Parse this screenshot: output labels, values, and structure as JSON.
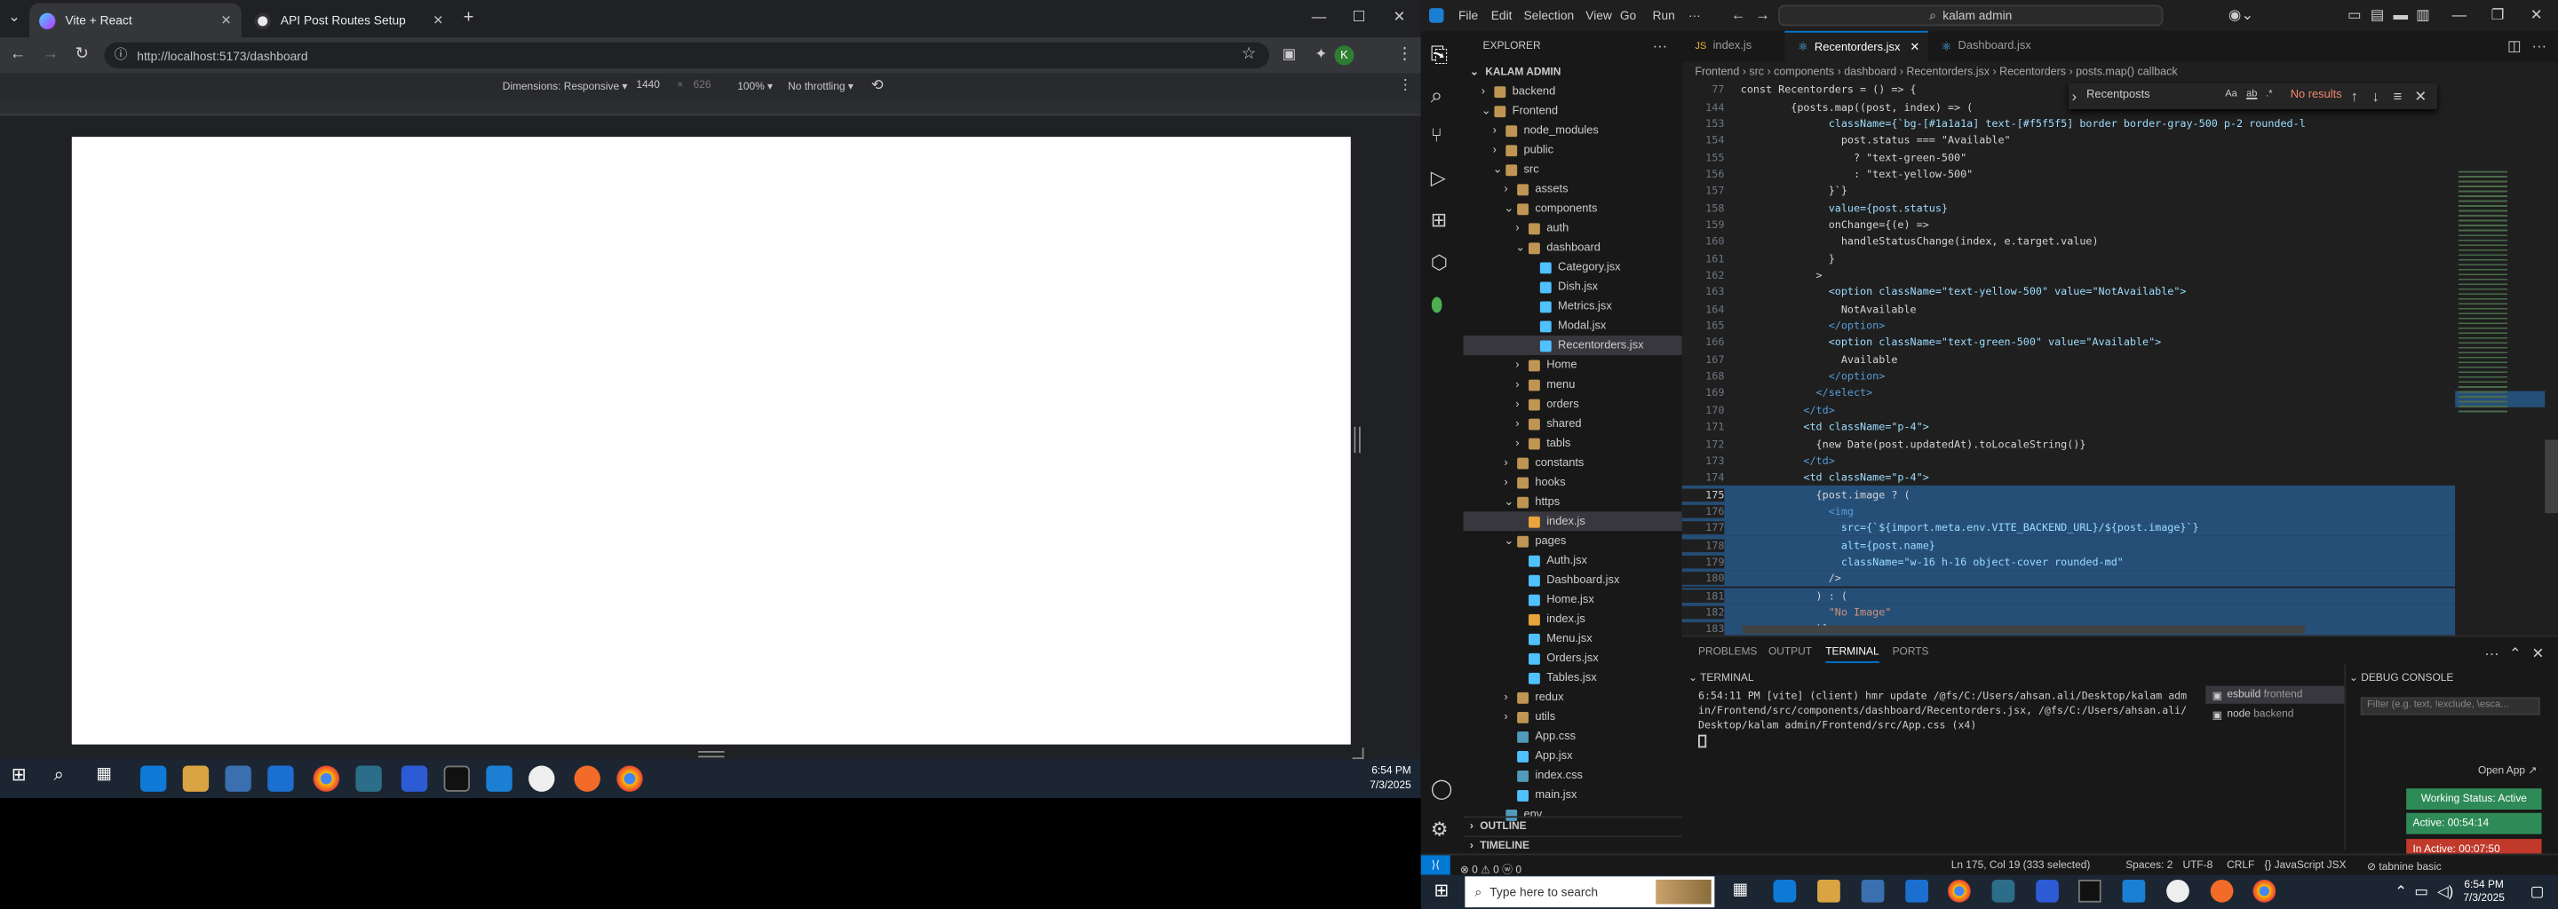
{
  "browser": {
    "tabs": [
      {
        "title": "Vite + React",
        "color": "#646cff"
      },
      {
        "title": "API Post Routes Setup",
        "color": "#e8eaed"
      }
    ],
    "url": "http://localhost:5173/dashboard",
    "device": "Dimensions: Responsive ▾",
    "width": "1440",
    "height": "626",
    "zoom": "100% ▾",
    "throttle": "No throttling ▾",
    "avatar": "K"
  },
  "taskbar_left": {
    "time": "6:54 PM",
    "date": "7/3/2025"
  },
  "vscode": {
    "menu": [
      "File",
      "Edit",
      "Selection",
      "View",
      "Go",
      "Run",
      "···"
    ],
    "search": "kalam admin",
    "explorer_title": "EXPLORER",
    "root": "KALAM ADMIN",
    "tree": [
      {
        "l": "backend",
        "d": 1,
        "t": "c"
      },
      {
        "l": "Frontend",
        "d": 1,
        "t": "o"
      },
      {
        "l": "node_modules",
        "d": 2,
        "t": "c"
      },
      {
        "l": "public",
        "d": 2,
        "t": "c"
      },
      {
        "l": "src",
        "d": 2,
        "t": "o"
      },
      {
        "l": "assets",
        "d": 3,
        "t": "c"
      },
      {
        "l": "components",
        "d": 3,
        "t": "o"
      },
      {
        "l": "auth",
        "d": 4,
        "t": "c"
      },
      {
        "l": "dashboard",
        "d": 4,
        "t": "o"
      },
      {
        "l": "Category.jsx",
        "d": 5,
        "t": "j"
      },
      {
        "l": "Dish.jsx",
        "d": 5,
        "t": "j"
      },
      {
        "l": "Metrics.jsx",
        "d": 5,
        "t": "j"
      },
      {
        "l": "Modal.jsx",
        "d": 5,
        "t": "j"
      },
      {
        "l": "Recentorders.jsx",
        "d": 5,
        "t": "j",
        "sel": true
      },
      {
        "l": "Home",
        "d": 4,
        "t": "c"
      },
      {
        "l": "menu",
        "d": 4,
        "t": "c"
      },
      {
        "l": "orders",
        "d": 4,
        "t": "c"
      },
      {
        "l": "shared",
        "d": 4,
        "t": "c"
      },
      {
        "l": "tabls",
        "d": 4,
        "t": "c"
      },
      {
        "l": "constants",
        "d": 3,
        "t": "c"
      },
      {
        "l": "hooks",
        "d": 3,
        "t": "c"
      },
      {
        "l": "https",
        "d": 3,
        "t": "o"
      },
      {
        "l": "index.js",
        "d": 4,
        "t": "s",
        "sel2": true
      },
      {
        "l": "pages",
        "d": 3,
        "t": "o"
      },
      {
        "l": "Auth.jsx",
        "d": 4,
        "t": "j"
      },
      {
        "l": "Dashboard.jsx",
        "d": 4,
        "t": "j"
      },
      {
        "l": "Home.jsx",
        "d": 4,
        "t": "j"
      },
      {
        "l": "index.js",
        "d": 4,
        "t": "s"
      },
      {
        "l": "Menu.jsx",
        "d": 4,
        "t": "j"
      },
      {
        "l": "Orders.jsx",
        "d": 4,
        "t": "j"
      },
      {
        "l": "Tables.jsx",
        "d": 4,
        "t": "j"
      },
      {
        "l": "redux",
        "d": 3,
        "t": "c"
      },
      {
        "l": "utils",
        "d": 3,
        "t": "c"
      },
      {
        "l": "App.css",
        "d": 3,
        "t": "f"
      },
      {
        "l": "App.jsx",
        "d": 3,
        "t": "j"
      },
      {
        "l": "index.css",
        "d": 3,
        "t": "f"
      },
      {
        "l": "main.jsx",
        "d": 3,
        "t": "j"
      },
      {
        "l": "env",
        "d": 2,
        "t": "f"
      }
    ],
    "outline": "OUTLINE",
    "timeline": "TIMELINE",
    "editor_tabs": [
      "index.js",
      "Recentorders.jsx",
      "Dashboard.jsx"
    ],
    "breadcrumbs": "Frontend › src › components › dashboard › Recentorders.jsx › Recentorders › posts.map() callback",
    "find": {
      "query": "Recentposts",
      "result": "No results"
    },
    "code": [
      [
        "77",
        "const Recentorders = () => {"
      ],
      [
        "144",
        "        {posts.map((post, index) => ("
      ],
      [
        "153",
        "              className={`bg-[#1a1a1a] text-[#f5f5f5] border border-gray-500 p-2 rounded-l"
      ],
      [
        "154",
        "                post.status === \"Available\""
      ],
      [
        "155",
        "                  ? \"text-green-500\""
      ],
      [
        "156",
        "                  : \"text-yellow-500\""
      ],
      [
        "157",
        "              }`}"
      ],
      [
        "158",
        "              value={post.status}"
      ],
      [
        "159",
        "              onChange={(e) =>"
      ],
      [
        "160",
        "                handleStatusChange(index, e.target.value)"
      ],
      [
        "161",
        "              }"
      ],
      [
        "162",
        "            >"
      ],
      [
        "163",
        "              <option className=\"text-yellow-500\" value=\"NotAvailable\">"
      ],
      [
        "164",
        "                NotAvailable"
      ],
      [
        "165",
        "              </option>"
      ],
      [
        "166",
        "              <option className=\"text-green-500\" value=\"Available\">"
      ],
      [
        "167",
        "                Available"
      ],
      [
        "168",
        "              </option>"
      ],
      [
        "169",
        "            </select>"
      ],
      [
        "170",
        "          </td>"
      ],
      [
        "171",
        "          <td className=\"p-4\">"
      ],
      [
        "172",
        "            {new Date(post.updatedAt).toLocaleString()}"
      ],
      [
        "173",
        "          </td>"
      ],
      [
        "174",
        "          <td className=\"p-4\">"
      ],
      [
        "175",
        "            {post.image ? ("
      ],
      [
        "176",
        "              <img"
      ],
      [
        "177",
        "                src={`${import.meta.env.VITE_BACKEND_URL}/${post.image}`}"
      ],
      [
        "178",
        "                alt={post.name}"
      ],
      [
        "179",
        "                className=\"w-16 h-16 object-cover rounded-md\""
      ],
      [
        "180",
        "              />"
      ],
      [
        "181",
        "            ) : ("
      ],
      [
        "182",
        "              \"No Image\""
      ],
      [
        "183",
        "            )}"
      ]
    ],
    "panel_tabs": [
      "PROBLEMS",
      "OUTPUT",
      "TERMINAL",
      "PORTS"
    ],
    "terminal_label": "TERMINAL",
    "terminal_text": [
      "6:54:11 PM [vite] (client) hmr update /@fs/C:/Users/ahsan.ali/Desktop/kalam adm",
      "in/Frontend/src/components/dashboard/Recentorders.jsx, /@fs/C:/Users/ahsan.ali/",
      "Desktop/kalam admin/Frontend/src/App.css (x4)"
    ],
    "terminals": [
      {
        "name": "esbuild",
        "sub": "frontend"
      },
      {
        "name": "node",
        "sub": "backend"
      }
    ],
    "debug_title": "DEBUG CONSOLE",
    "debug_filter": "Filter (e.g. text, !exclude, \\esca...",
    "open_app": "Open App ↗",
    "badges": [
      {
        "t": "Working Status: Active",
        "c": "#2e8b57"
      },
      {
        "t": "Active: 00:54:14",
        "c": "#2e8b57"
      },
      {
        "t": "In Active: 00:07:50",
        "c": "#c0392b"
      }
    ],
    "status": {
      "left": "⊗ 0 ⚠ 0  ⓦ 0",
      "pos": "Ln 175, Col 19 (333 selected)",
      "spaces": "Spaces: 2",
      "enc": "UTF-8",
      "eol": "CRLF",
      "lang": "{} JavaScript JSX",
      "ext": "⊘ tabnine basic"
    }
  },
  "taskbar_right": {
    "search": "Type here to search",
    "time": "6:54 PM",
    "date": "7/3/2025"
  }
}
